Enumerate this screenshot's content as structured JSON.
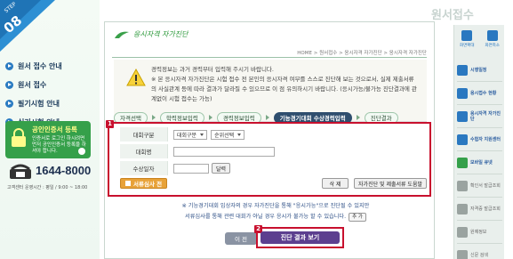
{
  "step_badge": {
    "label": "STEP",
    "number": "08"
  },
  "left_menu": [
    {
      "label": "원서 접수 안내"
    },
    {
      "label": "원서 접수"
    },
    {
      "label": "필기시험 안내"
    },
    {
      "label": "실기시험 안내"
    }
  ],
  "cert_box": {
    "title": "공인인증서 등록",
    "desc": "인증서로 로그인 하시려면 먼저 공인인증서 등록을 하셔야 합니다."
  },
  "phone": {
    "number": "1644-8000",
    "hours": "고객센터 운영시간 : 평일 / 9:00 ~ 18:00"
  },
  "page_heading": "원서접수",
  "logo_text": "응시자격 자가진단",
  "breadcrumb": "HOME > 원서접수 > 응시자격 자가진단 > 응시자격 자가진단",
  "notice": {
    "line1": "경력정보는 과거 경력부터 입력해 주시기 바랍니다.",
    "line2": "※ 본 응시자격 자가진단은 시험 접수 전 본인의 응시자격 여부를 스스로 진단해 보는 것으로서, 실제 제출서류의 사실관계 등에 따라 결과가 달라질 수 있으므로 이 점 유의하시기 바랍니다. (응시가능/불가능 진단결과에 관계없이 시험 접수는 가능)"
  },
  "steps": [
    {
      "label": "자격선택",
      "active": false
    },
    {
      "label": "학력정보입력",
      "active": false
    },
    {
      "label": "경력정보입력",
      "active": false
    },
    {
      "label": "기능경기대회 수상경력입력",
      "active": true
    },
    {
      "label": "진단결과",
      "active": false
    }
  ],
  "form": {
    "badge": "1",
    "row1_label": "대회구분",
    "select1": "대회구분",
    "select2": "순위선택",
    "row2_label": "대회명",
    "row3_label": "수상일자",
    "calendar_btn": "달력",
    "history_btn": "서류심사 전",
    "delete_btn": "삭 제",
    "guide_btn": "자가진단 및 제출서류 도움말"
  },
  "bottom_note": {
    "line1": "※ 기능경기대회 입상자의 경우 자가진단을 통해 \"응시가능\"으로 진단될 수 있지만",
    "line2": "서류심사를 통해 관련 대회가 아닐 경우 응시가 불가능 할 수 있습니다.",
    "add_btn": "추 가"
  },
  "prev_btn": "이 전",
  "result_badge": "2",
  "result_btn": "진단 결과 보기",
  "right_sidebar": {
    "head": [
      {
        "label": "화면확대"
      },
      {
        "label": "화면축소"
      }
    ],
    "items": [
      {
        "label": "시행일정",
        "color": "#2a78c0",
        "gray": false
      },
      {
        "label": "응시접수 현황",
        "color": "#2a78c0",
        "gray": false
      },
      {
        "label": "응시자격 자가진단",
        "color": "#2a78c0",
        "gray": false
      },
      {
        "label": "수험자 지원센터",
        "color": "#2a78c0",
        "gray": false
      },
      {
        "label": "모바일 큐넷",
        "color": "#35a04a",
        "gray": false
      },
      {
        "label": "확인서 발급조회",
        "color": "#9aa3a0",
        "gray": true
      },
      {
        "label": "자격증 발급조회",
        "color": "#9aa3a0",
        "gray": true
      },
      {
        "label": "원예정보",
        "color": "#9aa3a0",
        "gray": true
      },
      {
        "label": "신문 검색",
        "color": "#9aa3a0",
        "gray": true
      }
    ]
  }
}
